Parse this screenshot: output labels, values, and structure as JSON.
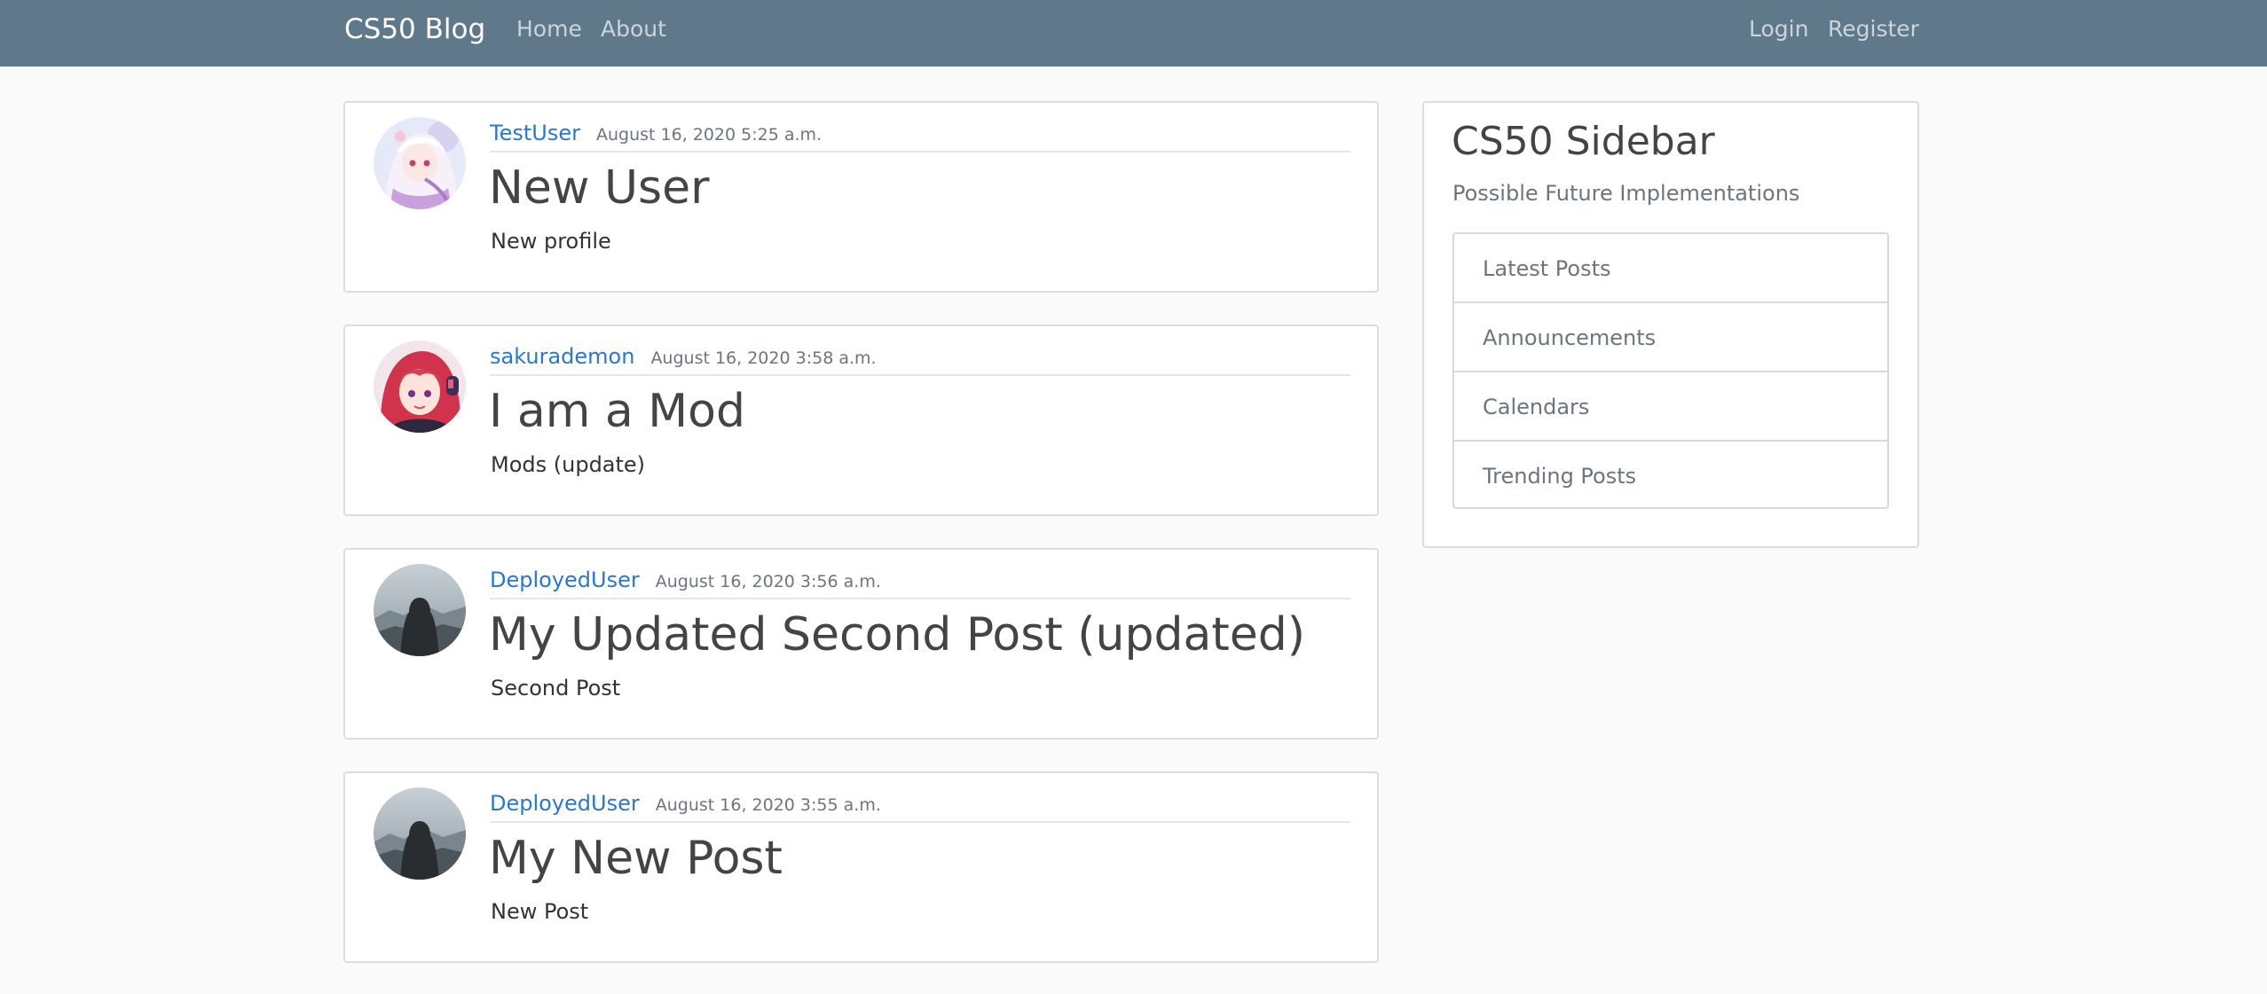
{
  "navbar": {
    "brand": "CS50 Blog",
    "left_links": [
      {
        "label": "Home"
      },
      {
        "label": "About"
      }
    ],
    "right_links": [
      {
        "label": "Login"
      },
      {
        "label": "Register"
      }
    ]
  },
  "posts": [
    {
      "author": "TestUser",
      "date": "August 16, 2020 5:25 a.m.",
      "title": "New User",
      "content": "New profile",
      "avatar": "anime-girl-white-hair-avatar"
    },
    {
      "author": "sakurademon",
      "date": "August 16, 2020 3:58 a.m.",
      "title": "I am a Mod",
      "content": "Mods (update)",
      "avatar": "anime-girl-red-hair-avatar"
    },
    {
      "author": "DeployedUser",
      "date": "August 16, 2020 3:56 a.m.",
      "title": "My Updated Second Post (updated)",
      "content": "Second Post",
      "avatar": "hooded-figure-avatar"
    },
    {
      "author": "DeployedUser",
      "date": "August 16, 2020 3:55 a.m.",
      "title": "My New Post",
      "content": "New Post",
      "avatar": "hooded-figure-avatar"
    }
  ],
  "sidebar": {
    "title": "CS50 Sidebar",
    "subtitle": "Possible Future Implementations",
    "items": [
      {
        "label": "Latest Posts"
      },
      {
        "label": "Announcements"
      },
      {
        "label": "Calendars"
      },
      {
        "label": "Trending Posts"
      }
    ]
  },
  "colors": {
    "navbar_bg": "#5f788a",
    "page_bg": "#fafafa",
    "link_blue": "#2b78c6"
  }
}
